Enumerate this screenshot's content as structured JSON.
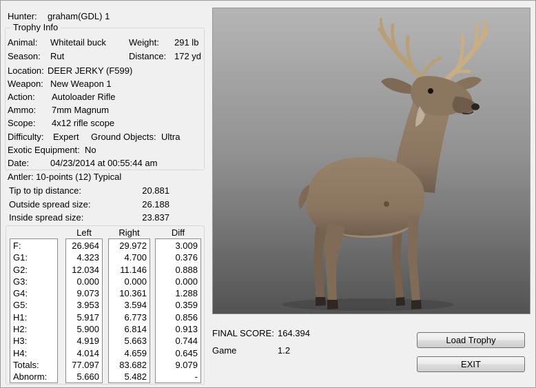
{
  "window": {
    "bg_color": "#f0f0f0",
    "viewer_top_color": "#b5b5b5",
    "viewer_bottom_color": "#525252"
  },
  "hunter": {
    "label": "Hunter:",
    "value": "graham(GDL) 1"
  },
  "trophy_group": {
    "title": "Trophy Info"
  },
  "fields": {
    "animal": {
      "label": "Animal:",
      "value": "Whitetail buck"
    },
    "weight": {
      "label": "Weight:",
      "value": "291 lb"
    },
    "season": {
      "label": "Season:",
      "value": "Rut"
    },
    "distance": {
      "label": "Distance:",
      "value": "172 yd"
    },
    "location": {
      "label": "Location:",
      "value": "DEER JERKY (F599)"
    },
    "weapon": {
      "label": "Weapon:",
      "value": "New Weapon 1"
    },
    "action": {
      "label": "Action:",
      "value": "Autoloader Rifle"
    },
    "ammo": {
      "label": "Ammo:",
      "value": "7mm Magnum"
    },
    "scope": {
      "label": "Scope:",
      "value": "4x12 rifle scope"
    },
    "difficulty": {
      "label": "Difficulty:",
      "value": "Expert"
    },
    "ground_objects": {
      "label": "Ground Objects:",
      "value": "Ultra"
    },
    "exotic": {
      "label": "Exotic Equipment:",
      "value": "No"
    },
    "date": {
      "label": "Date:",
      "value": "04/23/2014 at 00:55:44 am"
    }
  },
  "antler": {
    "summary": "Antler: 10-points (12) Typical",
    "tip_to_tip": {
      "label": "Tip to tip distance:",
      "value": "20.881"
    },
    "outside_spread": {
      "label": "Outside spread size:",
      "value": "26.188"
    },
    "inside_spread": {
      "label": "Inside spread size:",
      "value": "23.837"
    }
  },
  "measurements": {
    "headers": [
      "Left",
      "Right",
      "Diff"
    ],
    "rows": [
      {
        "label": "F:",
        "left": "26.964",
        "right": "29.972",
        "diff": "3.009"
      },
      {
        "label": "G1:",
        "left": "4.323",
        "right": "4.700",
        "diff": "0.376"
      },
      {
        "label": "G2:",
        "left": "12.034",
        "right": "11.146",
        "diff": "0.888"
      },
      {
        "label": "G3:",
        "left": "0.000",
        "right": "0.000",
        "diff": "0.000"
      },
      {
        "label": "G4:",
        "left": "9.073",
        "right": "10.361",
        "diff": "1.288"
      },
      {
        "label": "G5:",
        "left": "3.953",
        "right": "3.594",
        "diff": "0.359"
      },
      {
        "label": "H1:",
        "left": "5.917",
        "right": "6.773",
        "diff": "0.856"
      },
      {
        "label": "H2:",
        "left": "5.900",
        "right": "6.814",
        "diff": "0.913"
      },
      {
        "label": "H3:",
        "left": "4.919",
        "right": "5.663",
        "diff": "0.744"
      },
      {
        "label": "H4:",
        "left": "4.014",
        "right": "4.659",
        "diff": "0.645"
      },
      {
        "label": "Totals:",
        "left": "77.097",
        "right": "83.682",
        "diff": "9.079"
      },
      {
        "label": "Abnorm:",
        "left": "5.660",
        "right": "5.482",
        "diff": "-"
      }
    ]
  },
  "viewer": {
    "alt": "3D render of a whitetail buck trophy"
  },
  "score": {
    "final_label": "FINAL SCORE:",
    "final_value": "164.394",
    "game_label": "Game",
    "game_value": "1.2"
  },
  "buttons": {
    "load_trophy": "Load Trophy",
    "exit": "EXIT"
  }
}
